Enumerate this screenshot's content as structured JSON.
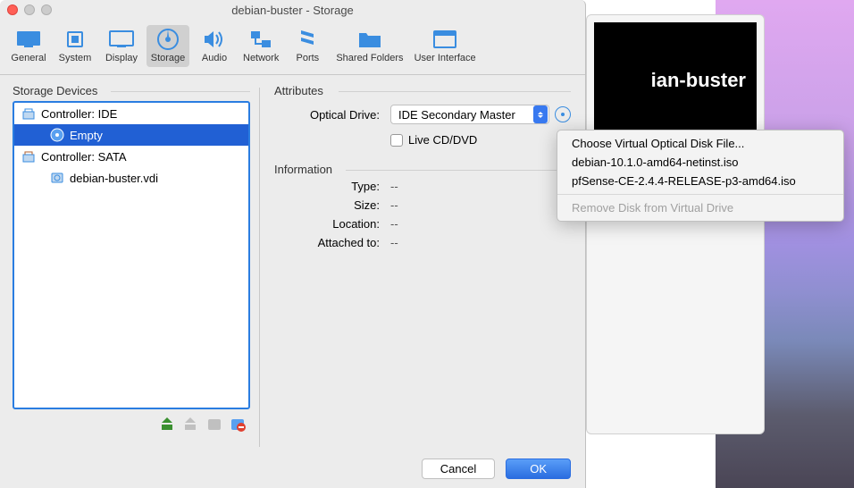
{
  "window": {
    "title": "debian-buster - Storage"
  },
  "preview": {
    "label": "ian-buster"
  },
  "toolbar": {
    "items": [
      {
        "label": "General"
      },
      {
        "label": "System"
      },
      {
        "label": "Display"
      },
      {
        "label": "Storage"
      },
      {
        "label": "Audio"
      },
      {
        "label": "Network"
      },
      {
        "label": "Ports"
      },
      {
        "label": "Shared Folders"
      },
      {
        "label": "User Interface"
      }
    ]
  },
  "left": {
    "section_title": "Storage Devices",
    "controller_ide": "Controller: IDE",
    "empty": "Empty",
    "controller_sata": "Controller: SATA",
    "vdi": "debian-buster.vdi"
  },
  "right": {
    "attributes_title": "Attributes",
    "optical_drive_label": "Optical Drive:",
    "optical_drive_value": "IDE Secondary Master",
    "live_cd_label": "Live CD/DVD",
    "information_title": "Information",
    "type_label": "Type:",
    "type_value": "--",
    "size_label": "Size:",
    "size_value": "--",
    "location_label": "Location:",
    "location_value": "--",
    "attached_label": "Attached to:",
    "attached_value": "--"
  },
  "buttons": {
    "cancel": "Cancel",
    "ok": "OK"
  },
  "popup": {
    "choose": "Choose Virtual Optical Disk File...",
    "iso1": "debian-10.1.0-amd64-netinst.iso",
    "iso2": "pfSense-CE-2.4.4-RELEASE-p3-amd64.iso",
    "remove": "Remove Disk from Virtual Drive"
  }
}
